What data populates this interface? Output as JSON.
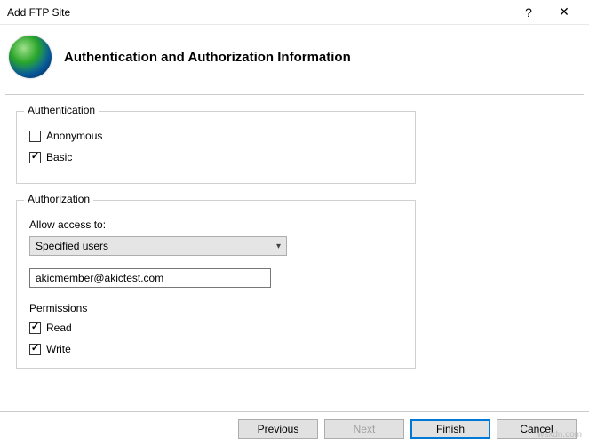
{
  "window": {
    "title": "Add FTP Site",
    "help_symbol": "?",
    "close_symbol": "✕"
  },
  "header": {
    "title": "Authentication and Authorization Information"
  },
  "auth_group": {
    "legend": "Authentication",
    "anonymous_label": "Anonymous",
    "basic_label": "Basic"
  },
  "authz_group": {
    "legend": "Authorization",
    "allow_access_label": "Allow access to:",
    "dropdown_selected": "Specified users",
    "users_value": "akicmember@akictest.com",
    "permissions_label": "Permissions",
    "read_label": "Read",
    "write_label": "Write"
  },
  "buttons": {
    "previous": "Previous",
    "next": "Next",
    "finish": "Finish",
    "cancel": "Cancel"
  },
  "watermark": "wsxdn.com"
}
